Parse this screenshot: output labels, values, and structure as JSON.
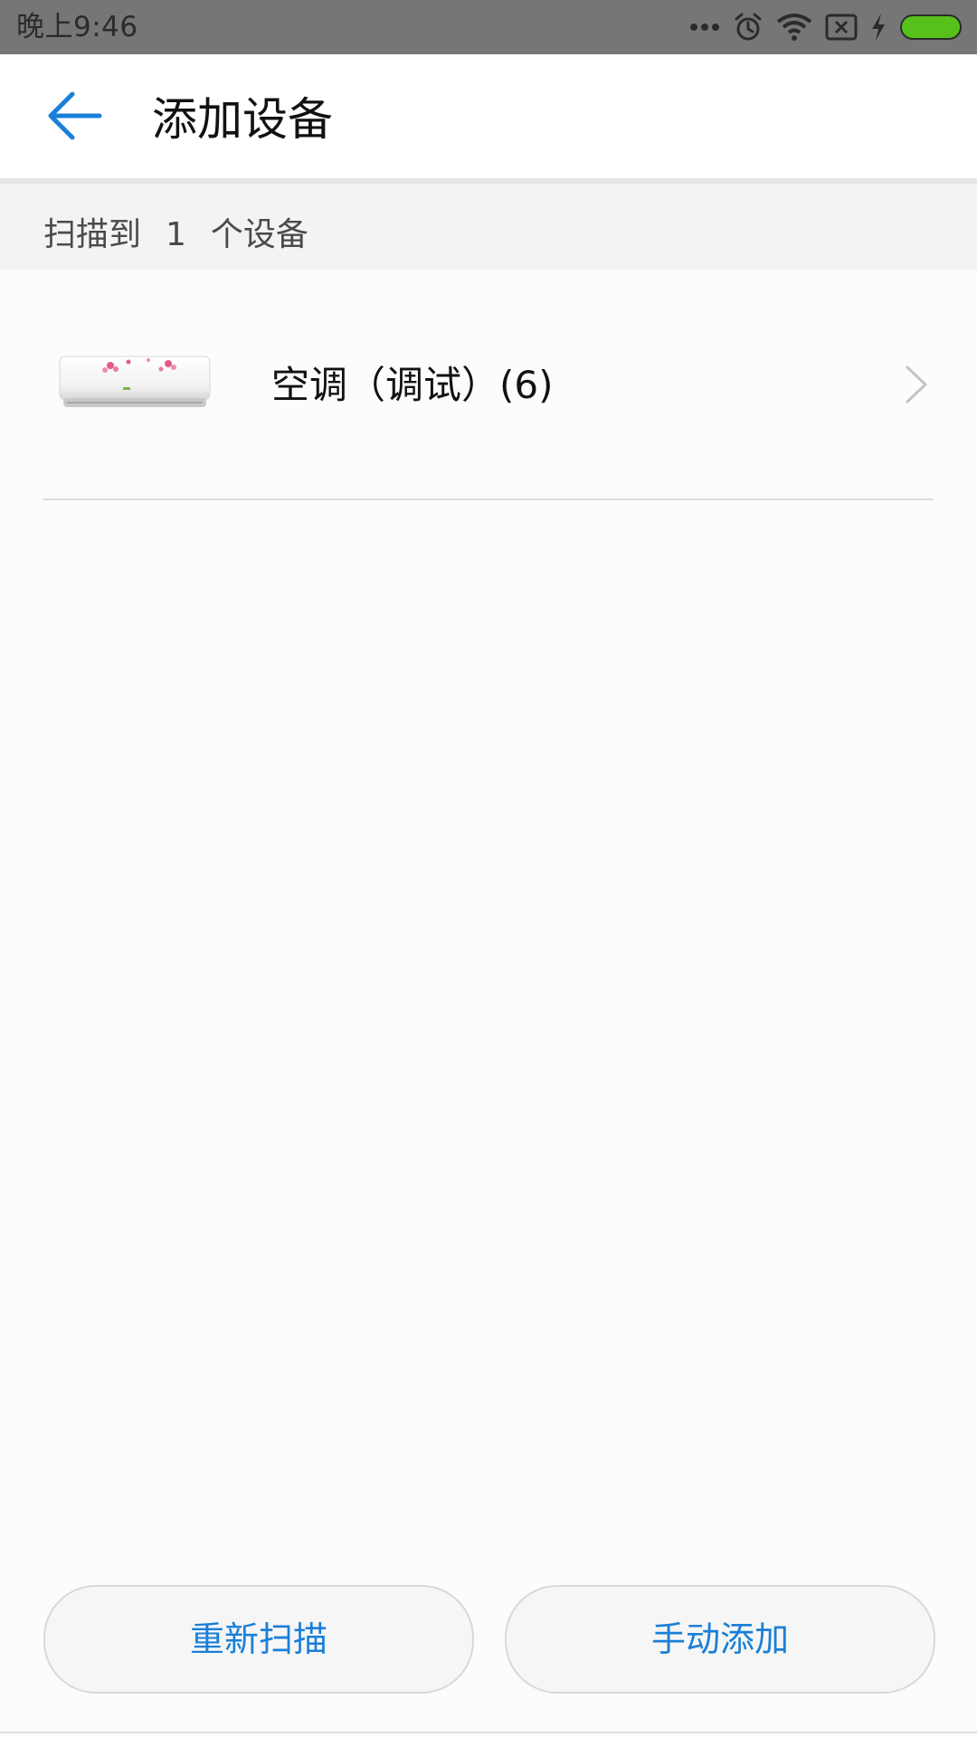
{
  "status_bar": {
    "time": "晚上9:46",
    "icons": [
      "more-dots-icon",
      "alarm-icon",
      "wifi-icon",
      "sim-x-icon",
      "charging-bolt-icon",
      "battery-icon"
    ],
    "battery_color": "#55c11a"
  },
  "header": {
    "title": "添加设备",
    "back_icon": "arrow-left-icon",
    "accent_color": "#1a7fd8"
  },
  "scan": {
    "prefix": "扫描到",
    "count": "1",
    "suffix": "个设备"
  },
  "devices": [
    {
      "name": "空调（调试）(6)",
      "image": "air-conditioner-image",
      "chevron": "chevron-right-icon"
    }
  ],
  "actions": {
    "rescan_label": "重新扫描",
    "manual_add_label": "手动添加"
  }
}
